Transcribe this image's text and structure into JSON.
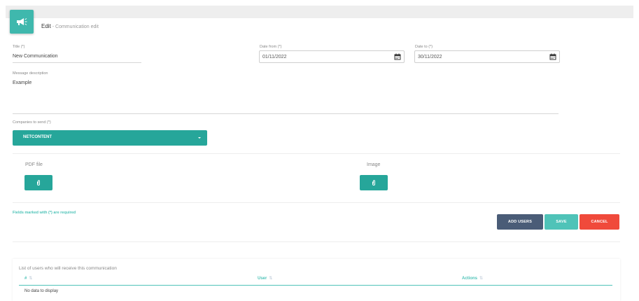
{
  "header": {
    "title": "Edit",
    "separator": " - ",
    "subtitle": "Communication edit",
    "icon": "megaphone-icon"
  },
  "form": {
    "title": {
      "label": "Title (*)",
      "value": "New Communication"
    },
    "date_from": {
      "label": "Date from (*)",
      "value": "01/11/2022",
      "icon": "calendar-icon"
    },
    "date_to": {
      "label": "Date to (*)",
      "value": "30/11/2022",
      "icon": "calendar-icon"
    },
    "message": {
      "label": "Message description",
      "value": "Example"
    },
    "companies": {
      "label": "Companies to send (*)",
      "selected": "NETCONTENT",
      "icon": "caret-down-icon"
    },
    "pdf": {
      "label": "PDF file",
      "icon": "paperclip-icon"
    },
    "image": {
      "label": "Image",
      "icon": "paperclip-icon"
    },
    "required_note": "Fields marked with (*) are required"
  },
  "actions": {
    "add_users": "ADD USERS",
    "save": "SAVE",
    "cancel": "CANCEL"
  },
  "table": {
    "title": "List of users who will receive this communication",
    "columns": [
      "#",
      "User",
      "Actions"
    ],
    "sort_icon": "⇅",
    "empty": "No data to display"
  },
  "colors": {
    "accent": "#26a69a",
    "accent_light": "#4fc3b8",
    "add_users": "#4a5c77",
    "cancel": "#f04a3b"
  }
}
